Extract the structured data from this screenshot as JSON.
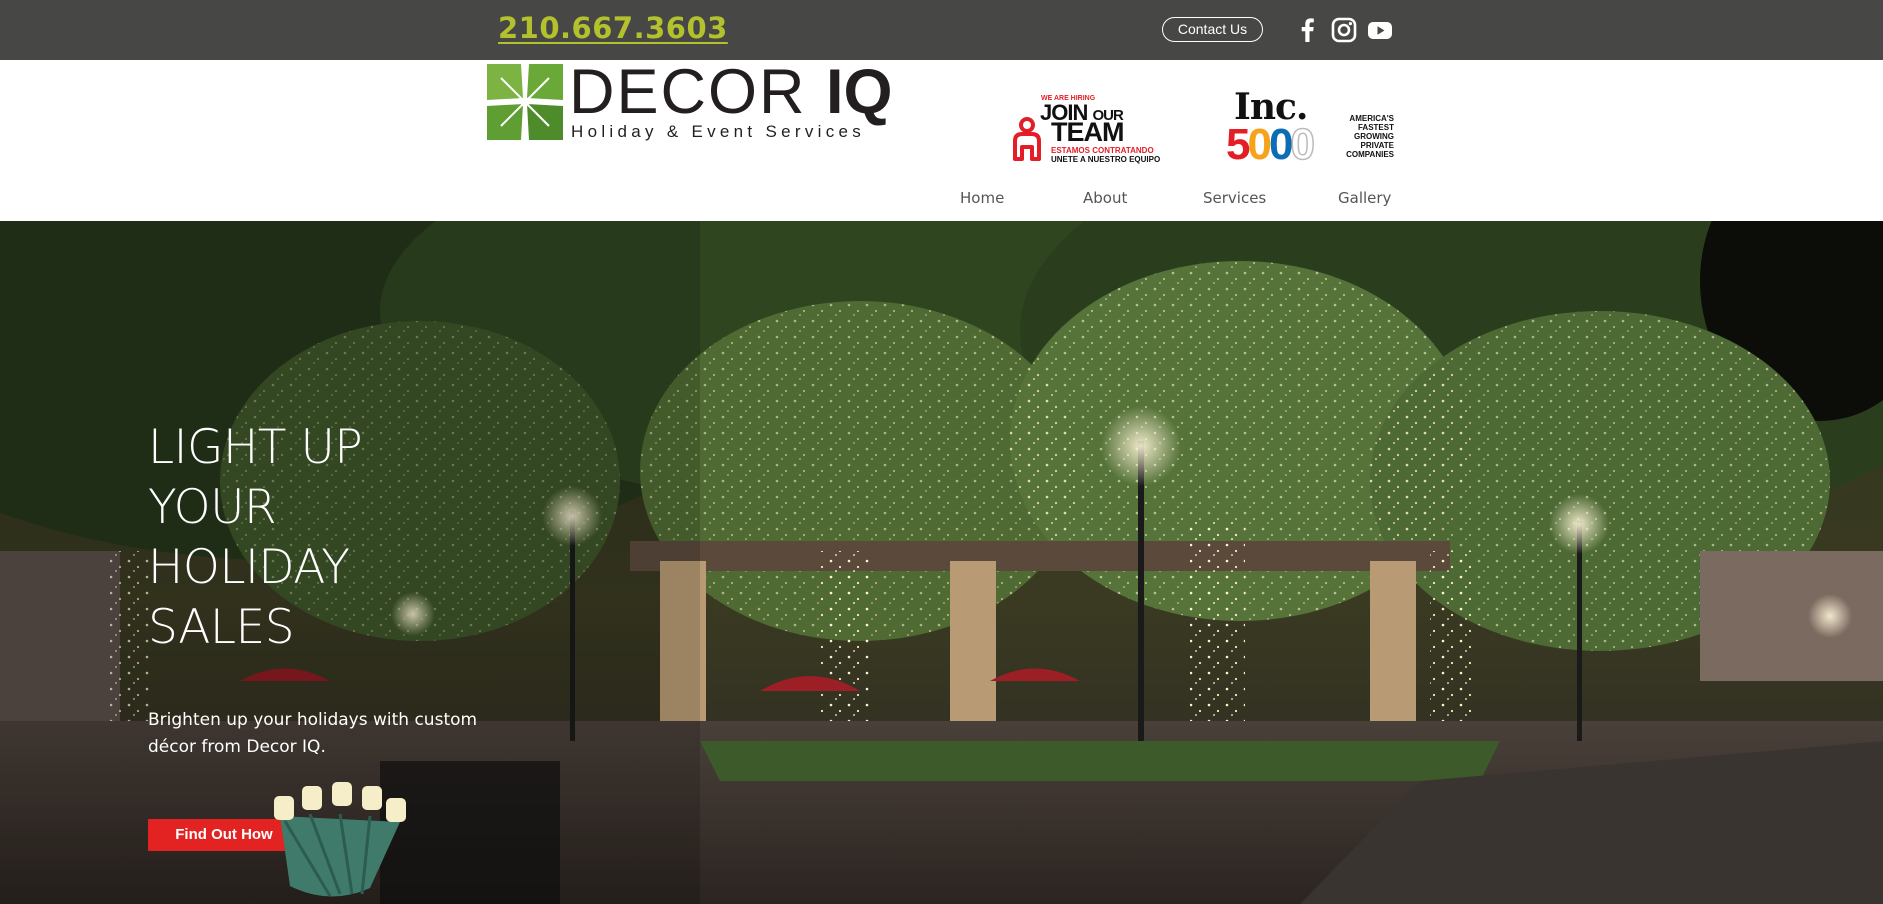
{
  "topbar": {
    "phone": "210.667.3603",
    "contact_label": "Contact Us",
    "social": [
      "facebook-icon",
      "instagram-icon",
      "youtube-icon"
    ]
  },
  "header": {
    "logo": {
      "name_main": "DECOR ",
      "name_bold": "IQ",
      "tagline": "Holiday & Event Services"
    },
    "join_badge": {
      "small": "WE ARE HIRING",
      "line1": "JOIN",
      "line1_small": "OUR",
      "line2": "TEAM",
      "es1": "ESTAMOS CONTRATANDO",
      "es2": "UNETE A NUESTRO EQUIPO"
    },
    "inc_badge": {
      "word": "Inc.",
      "digits": [
        "5",
        "0",
        "0",
        "0"
      ],
      "desc": [
        "AMERICA'S",
        "FASTEST",
        "GROWING",
        "PRIVATE",
        "COMPANIES"
      ]
    },
    "nav": [
      "Home",
      "About",
      "Services",
      "Gallery"
    ]
  },
  "hero": {
    "title_lines": [
      "LIGHT UP",
      "YOUR",
      "HOLIDAY",
      "SALES"
    ],
    "subtitle": "Brighten up your holidays with custom décor from Decor IQ.",
    "cta_label": "Find Out How"
  },
  "colors": {
    "topbar_bg": "#474746",
    "phone": "#b3c12d",
    "cta_bg": "#e22322",
    "logo_green": "#6aa838",
    "nav_text": "#555555"
  }
}
